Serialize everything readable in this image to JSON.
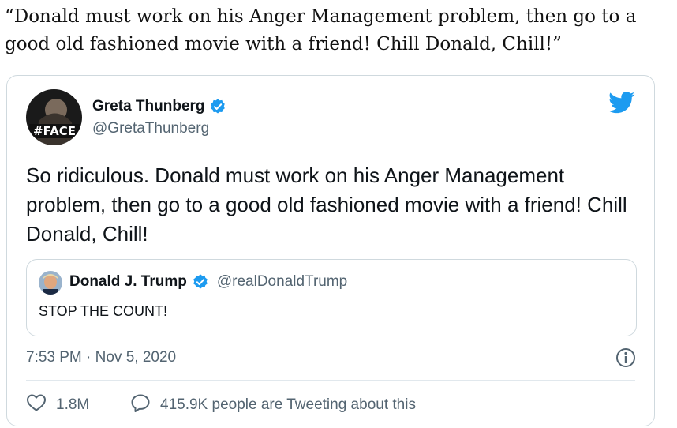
{
  "article": {
    "quote": "“Donald must work on his Anger Management problem, then go to a good old fashioned movie with a friend! Chill Donald, Chill!”"
  },
  "tweet": {
    "author_name": "Greta Thunberg",
    "author_handle": "@GretaThunberg",
    "avatar_text": "#FACE",
    "text": "So ridiculous. Donald must work on his Anger Management problem, then go to a good old fashioned movie with a friend! Chill Donald, Chill!",
    "timestamp": "7:53 PM · Nov 5, 2020",
    "likes": "1.8M",
    "talking_label": "415.9K people are Tweeting about this",
    "icons": [
      "verified-icon",
      "twitter-bird-icon",
      "info-icon",
      "heart-icon",
      "speech-bubble-icon"
    ],
    "accent_color": "#1d9bf0"
  },
  "quoted_tweet": {
    "author_name": "Donald J. Trump",
    "author_handle": "@realDonaldTrump",
    "text": "STOP THE COUNT!"
  }
}
